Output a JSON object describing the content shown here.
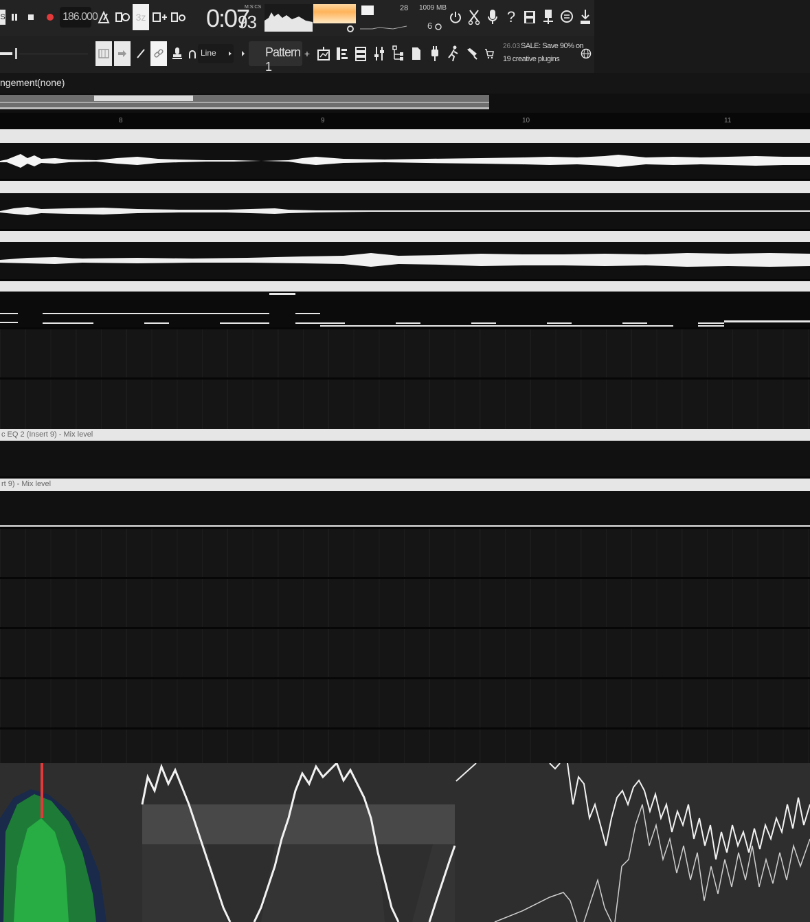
{
  "toolbar": {
    "tempo": "186.000",
    "time_main": "0:07",
    "time_sub": "93",
    "time_unit": "M:S:CS",
    "cpu_value": "28",
    "memory": "1009 MB",
    "poly_value": "6",
    "snap_mode": "Line",
    "pattern": "Pattern 1",
    "news_date": "26.03",
    "news_text_1": "SALE: Save 90% on",
    "news_text_2": "19 creative plugins",
    "mode_label": "3z"
  },
  "breadcrumb": {
    "part1": "ngement",
    "part2": "(none)"
  },
  "ruler": {
    "marks": [
      "8",
      "9",
      "10",
      "11"
    ]
  },
  "tracks": {
    "automation_1": "c EQ 2 (Insert 9) - Mix level",
    "automation_2": "rt 9) - Mix level"
  }
}
